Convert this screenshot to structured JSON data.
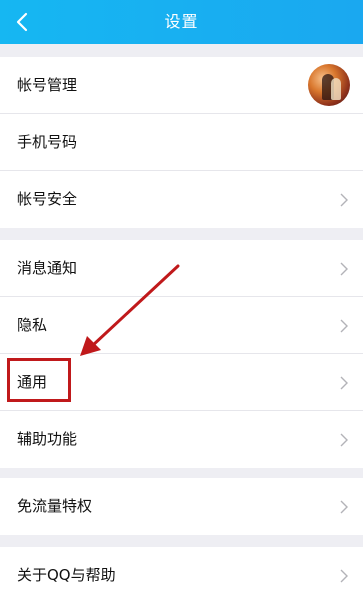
{
  "header": {
    "title": "设置"
  },
  "groups": [
    {
      "items": [
        {
          "label": "帐号管理"
        },
        {
          "label": "手机号码"
        },
        {
          "label": "帐号安全"
        }
      ]
    },
    {
      "items": [
        {
          "label": "消息通知"
        },
        {
          "label": "隐私"
        },
        {
          "label": "通用"
        },
        {
          "label": "辅助功能"
        }
      ]
    },
    {
      "items": [
        {
          "label": "免流量特权"
        }
      ]
    },
    {
      "items": [
        {
          "label": "关于QQ与帮助"
        }
      ]
    }
  ],
  "annotation": {
    "color": "#c0191b"
  },
  "icons": [
    "back-arrow-icon",
    "chevron-right-icon",
    "avatar"
  ]
}
